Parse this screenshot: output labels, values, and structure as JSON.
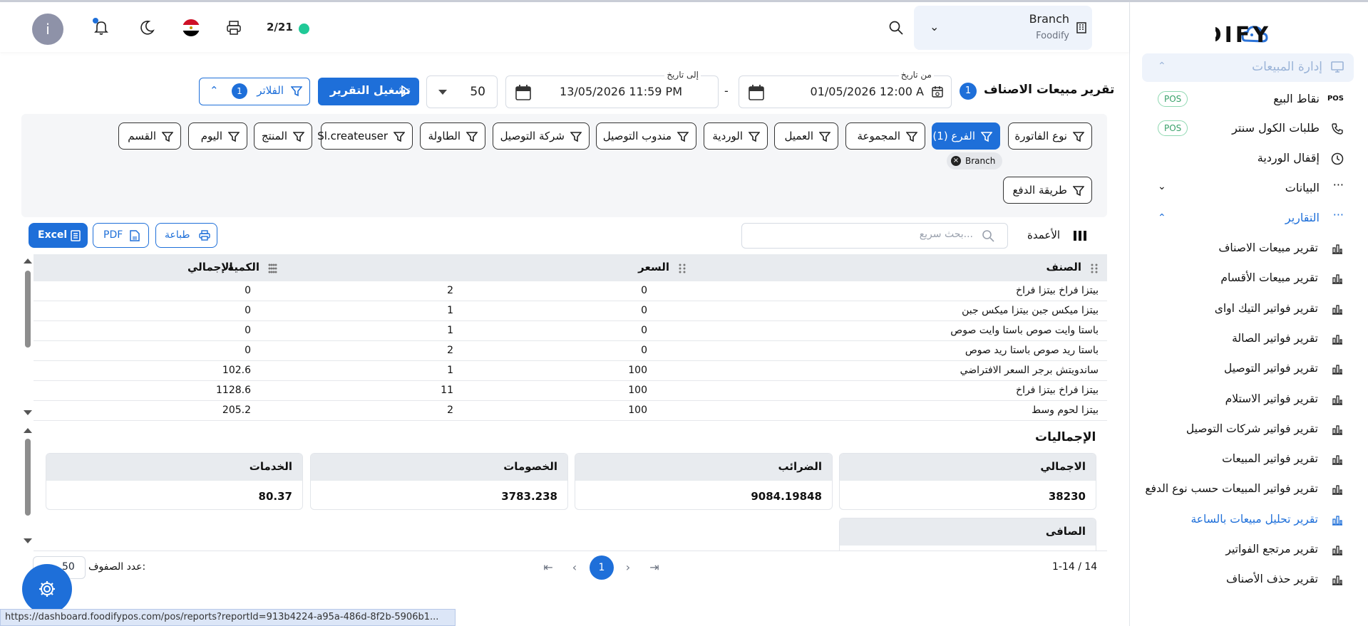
{
  "header": {
    "avatar_letter": "i",
    "counter": "2/21",
    "status_color": "#20c997",
    "branch_title": "Branch",
    "branch_subtitle": "Foodify",
    "flag": "egypt-flag"
  },
  "sidebar": {
    "logo_text": "FOODIFY",
    "section_title": "إدارة المبيعات",
    "items": [
      {
        "label": "نقاط البيع",
        "badge": "POS"
      },
      {
        "label": "طلبات الكول سنتر",
        "badge": "POS"
      },
      {
        "label": "إقفال الوردية"
      },
      {
        "label": "البيانات"
      },
      {
        "label": "التقارير"
      }
    ],
    "reports": [
      "تقرير مبيعات الاصناف",
      "تقرير مبيعات الأقسام",
      "تقرير فواتير التيك اواى",
      "تقرير فواتير الصالة",
      "تقرير فواتير التوصيل",
      "تقرير فواتير الاستلام",
      "تقرير فواتير شركات التوصيل",
      "تقرير فواتير المبيعات",
      "تقرير فواتير المبيعات حسب نوع الدفع",
      "تقرير تحليل مبيعات بالساعة",
      "تقرير مرتجع الفواتير",
      "تقرير حذف الأصناف"
    ],
    "active_report_index": 9
  },
  "controls": {
    "report_title": "تقرير مبيعات الاصناف",
    "title_count": "1",
    "from_label": "من تاريخ",
    "from_value": "01/05/2026 12:00 A",
    "to_label": "إلى تاريخ",
    "to_value": "13/05/2026 11:59 PM",
    "page_size": "50",
    "run_label": "تشغيل التقرير",
    "filters_label": "الفلاتر",
    "filters_count": "1"
  },
  "filters": {
    "row1": [
      "نوع الفاتورة",
      "الفرع (1)",
      "المجموعة",
      "العميل",
      "الوردية",
      "مندوب التوصيل",
      "شركة التوصيل",
      "الطاولة",
      "Sl.createuser",
      "المنتج",
      "اليوم",
      "القسم"
    ],
    "active_index": 1,
    "branch_tag": "Branch",
    "row2": [
      "طريقة الدفع"
    ]
  },
  "toolbar": {
    "columns_label": "الأعمدة",
    "search_placeholder": "بحث سريع...",
    "print_label": "طباعة",
    "pdf_label": "PDF",
    "excel_label": "Excel"
  },
  "table": {
    "headers": [
      "الصنف",
      "السعر",
      "الكمية",
      "الإجمالي"
    ],
    "rows": [
      [
        "بيتزا فراخ بيتزا فراخ",
        "0",
        "2",
        "0"
      ],
      [
        "بيتزا ميكس جبن بيتزا ميكس جبن",
        "0",
        "1",
        "0"
      ],
      [
        "باستا وايت صوص باستا وايت صوص",
        "0",
        "1",
        "0"
      ],
      [
        "باستا ريد صوص باستا ريد صوص",
        "0",
        "2",
        "0"
      ],
      [
        "ساندويتش برجر السعر الافتراضي",
        "100",
        "1",
        "102.6"
      ],
      [
        "بيتزا فراخ بيتزا فراخ",
        "100",
        "11",
        "1128.6"
      ],
      [
        "بيتزا لحوم وسط",
        "100",
        "2",
        "205.2"
      ]
    ]
  },
  "totals": {
    "title": "الإجماليات",
    "cards": [
      {
        "label": "الاجمالي",
        "value": "38230"
      },
      {
        "label": "الضرائب",
        "value": "9084.19848"
      },
      {
        "label": "الخصومات",
        "value": "3783.238"
      },
      {
        "label": "الخدمات",
        "value": "80.37"
      }
    ],
    "net_label": "الصافى"
  },
  "pagination": {
    "range": "1-14 / 14",
    "current_page": "1",
    "rows_label": "عدد الصفوف:",
    "rows_value": "50"
  },
  "status_url": "https://dashboard.foodifypos.com/pos/reports?reportId=913b4224-a95a-486d-8f2b-5906b1...",
  "colors": {
    "primary": "#1e6fd9",
    "pos_badge": "#38a169"
  }
}
